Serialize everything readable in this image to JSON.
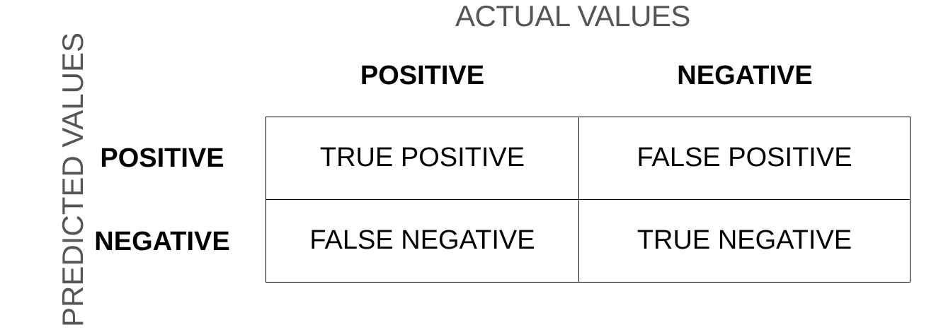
{
  "axes": {
    "actual_title": "ACTUAL VALUES",
    "predicted_title": "PREDICTED VALUES"
  },
  "columns": {
    "positive": "POSITIVE",
    "negative": "NEGATIVE"
  },
  "rows": {
    "positive": "POSITIVE",
    "negative": "NEGATIVE"
  },
  "cells": {
    "true_positive": "TRUE POSITIVE",
    "false_positive": "FALSE POSITIVE",
    "false_negative": "FALSE NEGATIVE",
    "true_negative": "TRUE NEGATIVE"
  },
  "colors": {
    "axis_title": "#555555",
    "text": "#000000",
    "border": "#000000",
    "background": "#ffffff"
  }
}
